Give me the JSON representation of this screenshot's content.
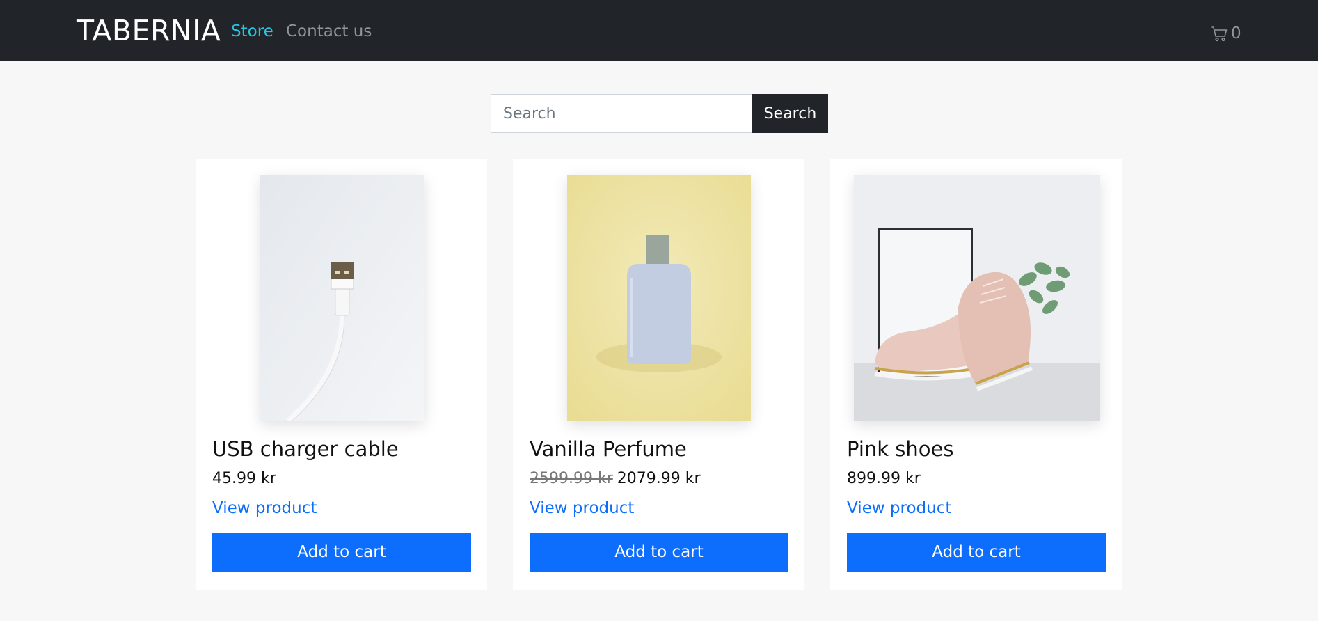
{
  "nav": {
    "brand": "TABERNIA",
    "links": [
      {
        "label": "Store"
      },
      {
        "label": "Contact us"
      }
    ],
    "cart_count": "0"
  },
  "search": {
    "placeholder": "Search",
    "button_label": "Search"
  },
  "products": [
    {
      "title": "USB charger cable",
      "price": "45.99 kr",
      "view_label": "View product",
      "cart_label": "Add to cart",
      "image": "usb-cable-photo"
    },
    {
      "title": "Vanilla Perfume",
      "old_price": "2599.99 kr",
      "price": "2079.99 kr",
      "view_label": "View product",
      "cart_label": "Add to cart",
      "image": "perfume-bottle-photo"
    },
    {
      "title": "Pink shoes",
      "price": "899.99 kr",
      "view_label": "View product",
      "cart_label": "Add to cart",
      "image": "pink-shoes-photo"
    }
  ],
  "colors": {
    "navbar": "#212529",
    "active_link": "#2bc4e0",
    "primary": "#0d6efd",
    "page_bg": "#f7f7f7"
  }
}
